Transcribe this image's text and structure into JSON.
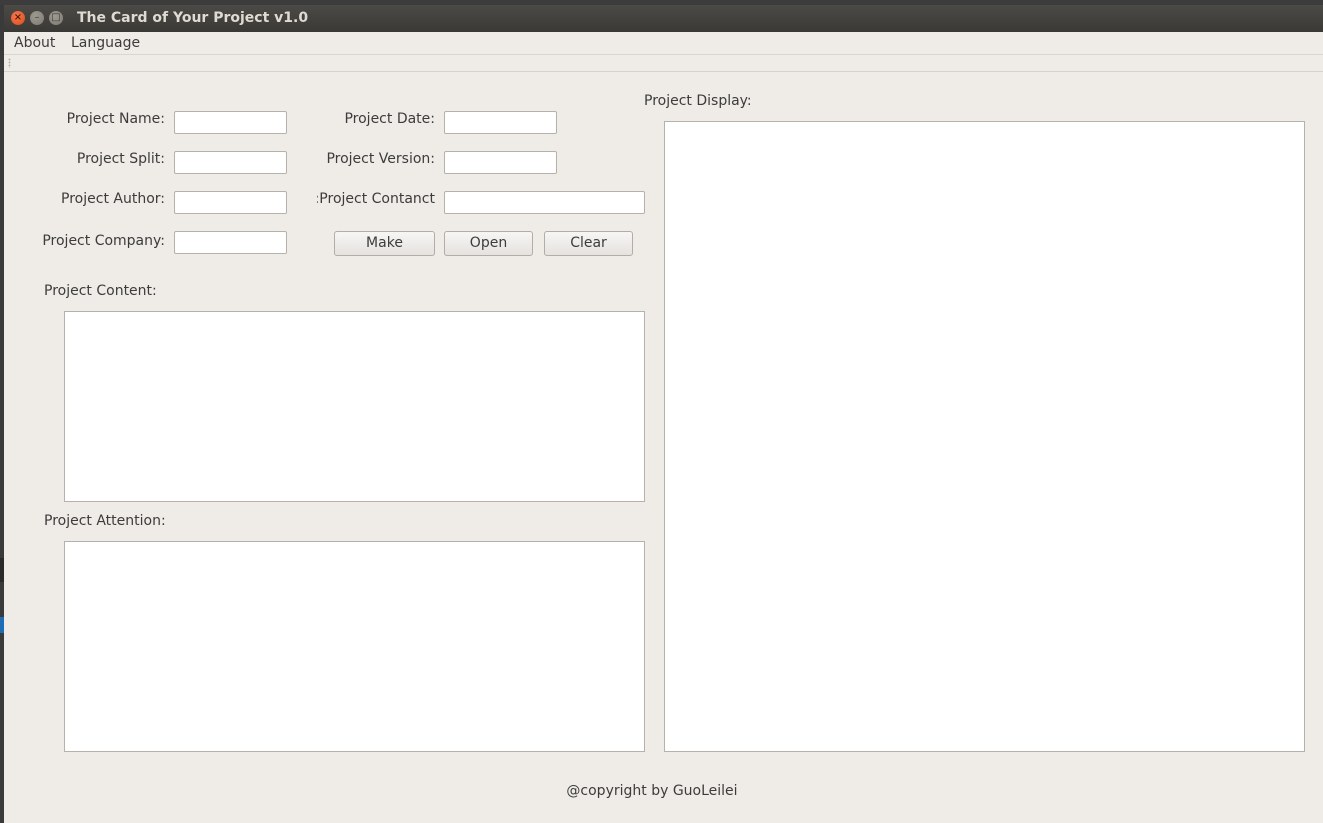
{
  "window": {
    "title": "The Card of Your Project v1.0",
    "close_glyph": "×",
    "min_glyph": "–",
    "max_glyph": "□"
  },
  "menu": {
    "about": "About",
    "language": "Language"
  },
  "form": {
    "name_label": "Project Name:",
    "split_label": "Project Split:",
    "author_label": "Project Author:",
    "company_label": "Project Company:",
    "date_label": "Project Date:",
    "version_label": "Project Version:",
    "contact_label": "Project Contanct:",
    "name_value": "",
    "split_value": "",
    "author_value": "",
    "company_value": "",
    "date_value": "",
    "version_value": "",
    "contact_value": ""
  },
  "buttons": {
    "make": "Make",
    "open": "Open",
    "clear": "Clear"
  },
  "content": {
    "label": "Project Content:",
    "value": ""
  },
  "attention": {
    "label": "Project Attention:",
    "value": ""
  },
  "display": {
    "label": "Project Display:",
    "value": ""
  },
  "footer": {
    "copyright": "@copyright by GuoLeilei"
  },
  "colors": {
    "window_bg": "#efebe7",
    "titlebar_bg": "#3c3b37",
    "close_button": "#df4a16"
  }
}
